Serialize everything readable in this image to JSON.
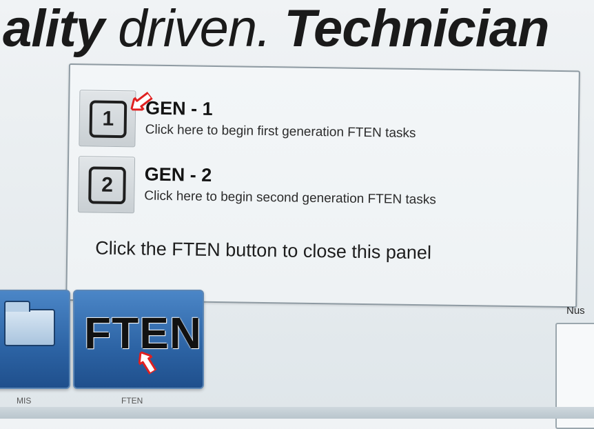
{
  "banner": {
    "part1": "ality",
    "part2": " driven. ",
    "part3": "Technician"
  },
  "panel": {
    "gen1": {
      "number": "1",
      "title": "GEN - 1",
      "description": "Click here to begin first generation FTEN tasks"
    },
    "gen2": {
      "number": "2",
      "title": "GEN - 2",
      "description": "Click here to begin second generation FTEN tasks"
    },
    "footer": "Click the FTEN button to close this panel"
  },
  "tiles": {
    "mis_caption": "MIS",
    "ften_label": "FTEN",
    "ften_caption": "FTEN"
  },
  "side": {
    "label": "Nus"
  },
  "colors": {
    "annotation_arrow": "#e02020",
    "tile_blue": "#2c63a4"
  },
  "icons": {
    "folder": "folder-icon",
    "annotation": "arrow-pointer-icon"
  }
}
